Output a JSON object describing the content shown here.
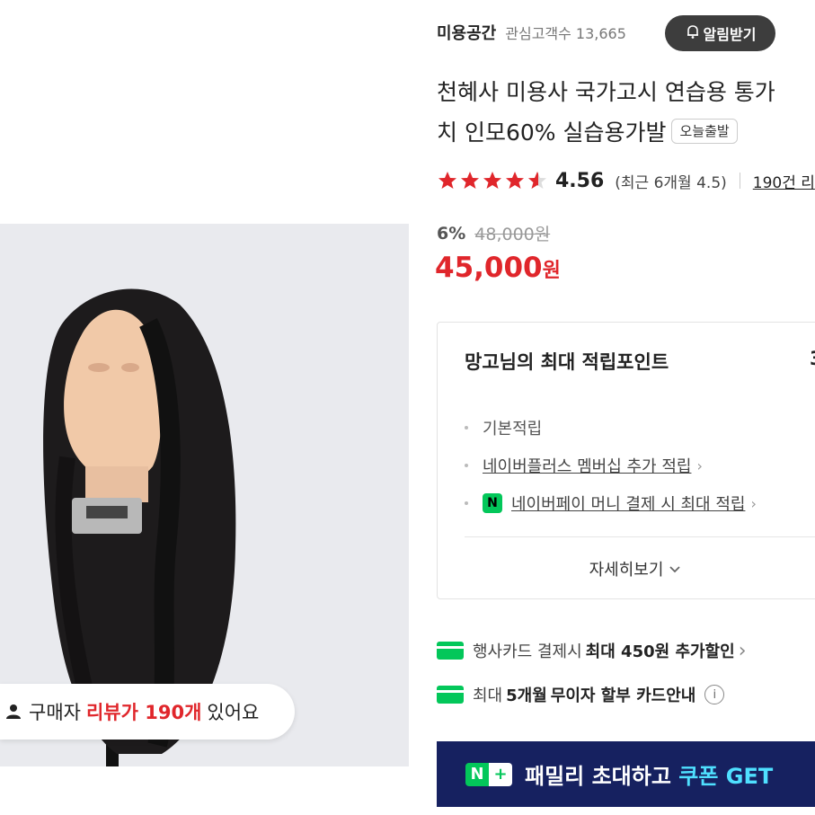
{
  "store": {
    "name": "미용공간",
    "follower_label": "관심고객수 13,665",
    "alarm_label": "알림받기"
  },
  "product": {
    "title_line1": "천혜사 미용사 국가고시 연습용 통가",
    "title_line2": "치 인모60% 실습용가발",
    "badge": "오늘출발",
    "rating": "4.56",
    "recent_rating": "(최근 6개월 4.5)",
    "review_link": "190건 리",
    "discount": "6%",
    "original_price": "48,000원",
    "price": "45,000",
    "price_unit": "원"
  },
  "review_pill": {
    "prefix": "구매자",
    "highlight": "리뷰가 190개",
    "suffix": "있어요"
  },
  "points": {
    "title": "망고님의 최대 적립포인트",
    "value_partial": "3",
    "items": [
      "기본적립",
      "네이버플러스 멤버십 추가 적립",
      "네이버페이 머니 결제 시 최대 적립"
    ],
    "more_label": "자세히보기"
  },
  "cards": [
    {
      "pre": "행사카드 결제시",
      "bold": "최대 450원 추가할인"
    },
    {
      "pre": "최대",
      "bold": "5개월",
      "mid": "무이자 할부 카드안내"
    }
  ],
  "banner": {
    "text": "패밀리 초대하고",
    "highlight": "쿠폰 GET"
  },
  "colors": {
    "accent_red": "#e0262b",
    "naver_green": "#03c75a",
    "banner_bg": "#162160"
  }
}
